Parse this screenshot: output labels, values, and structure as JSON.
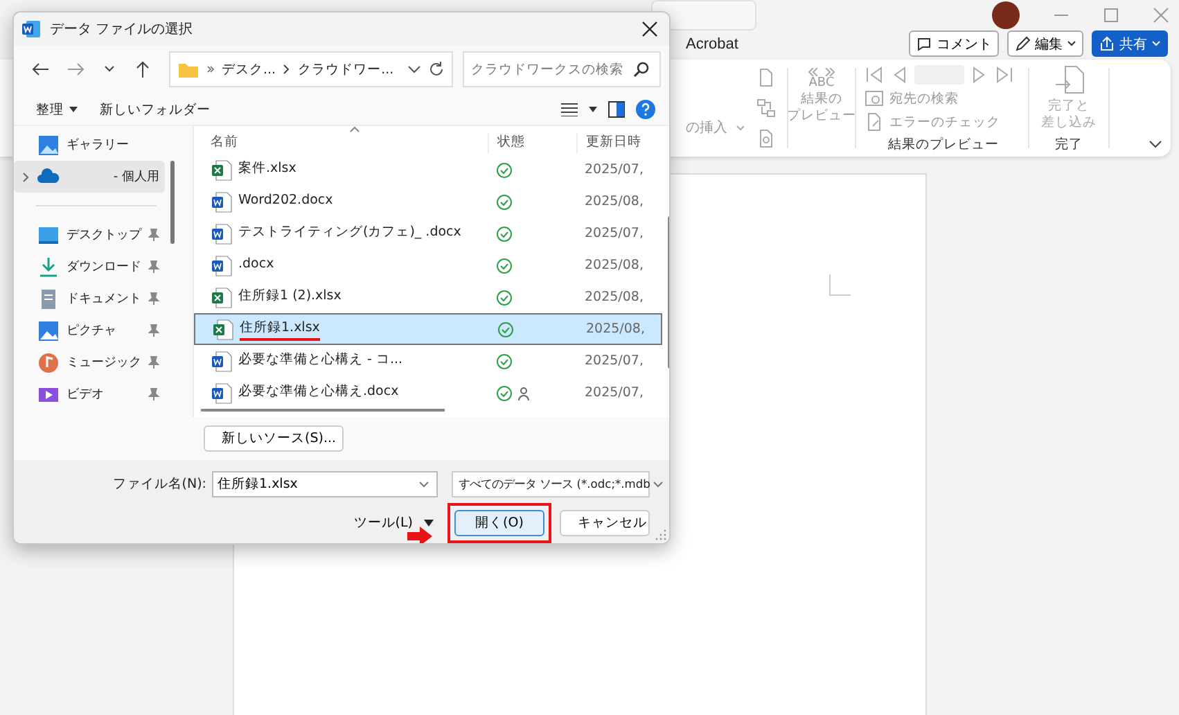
{
  "word_window": {
    "ribbon_tab": "Acrobat",
    "header_buttons": [
      {
        "label": "コメント",
        "kind": "comment"
      },
      {
        "label": "編集",
        "kind": "edit"
      },
      {
        "label": "共有",
        "kind": "share"
      }
    ],
    "ribbon": {
      "insert_field_partial": "の挿入",
      "preview_icon_label": "ABC",
      "preview_results": [
        "結果の",
        "プレビュー"
      ],
      "find_recipient": "宛先の検索",
      "check_errors": "エラーのチェック",
      "preview_group_label": "結果のプレビュー",
      "finish_merge": [
        "完了と",
        "差し込み"
      ],
      "finish_group_label": "完了"
    }
  },
  "dialog": {
    "title": "データ ファイルの選択",
    "path": [
      "デスク...",
      "クラウドワー..."
    ],
    "search": {
      "placeholder": "クラウドワークスの検索"
    },
    "organize": "整理",
    "new_folder": "新しいフォルダー",
    "sidebar": [
      {
        "label": "ギャラリー",
        "kind": "gallery",
        "selected": false,
        "pinned": false
      },
      {
        "label": "- 個人用",
        "kind": "cloud",
        "selected": true,
        "pinned": false
      },
      {
        "label": "デスクトップ",
        "kind": "desktop",
        "selected": false,
        "pinned": true
      },
      {
        "label": "ダウンロード",
        "kind": "download",
        "selected": false,
        "pinned": true
      },
      {
        "label": "ドキュメント",
        "kind": "documents",
        "selected": false,
        "pinned": true
      },
      {
        "label": "ピクチャ",
        "kind": "pictures",
        "selected": false,
        "pinned": true
      },
      {
        "label": "ミュージック",
        "kind": "music",
        "selected": false,
        "pinned": true
      },
      {
        "label": "ビデオ",
        "kind": "video",
        "selected": false,
        "pinned": true
      }
    ],
    "columns": [
      "名前",
      "状態",
      "更新日時"
    ],
    "rows": [
      {
        "name": "案件.xlsx",
        "kind": "excel",
        "shared": false,
        "date": "2025/07,",
        "selected": false,
        "underlined": false
      },
      {
        "name": "Word202.docx",
        "kind": "word",
        "shared": false,
        "date": "2025/08,",
        "selected": false,
        "underlined": false
      },
      {
        "name": "テストライティング(カフェ)_ .docx",
        "kind": "word",
        "shared": false,
        "date": "2025/07,",
        "selected": false,
        "underlined": false
      },
      {
        "name": ".docx",
        "kind": "word",
        "shared": false,
        "date": "2025/08,",
        "selected": false,
        "underlined": false
      },
      {
        "name": "住所録1 (2).xlsx",
        "kind": "excel",
        "shared": false,
        "date": "2025/08,",
        "selected": false,
        "underlined": false
      },
      {
        "name": "住所録1.xlsx",
        "kind": "excel",
        "shared": false,
        "date": "2025/08,",
        "selected": true,
        "underlined": true
      },
      {
        "name": "必要な準備と心構え - コ...",
        "kind": "word",
        "shared": false,
        "date": "2025/07,",
        "selected": false,
        "underlined": false
      },
      {
        "name": "必要な準備と心構え.docx",
        "kind": "word",
        "shared": true,
        "date": "2025/07,",
        "selected": false,
        "underlined": false
      }
    ],
    "new_source": "新しいソース(S)...",
    "filename_label": "ファイル名(N):",
    "filename_value": "住所録1.xlsx",
    "filter": "すべてのデータ ソース (*.odc;*.mdb",
    "tools": "ツール(L)",
    "buttons": [
      {
        "label": "開く(O)",
        "kind": "open",
        "highlighted": true
      },
      {
        "label": "キャンセル",
        "kind": "cancel",
        "highlighted": false
      }
    ]
  }
}
